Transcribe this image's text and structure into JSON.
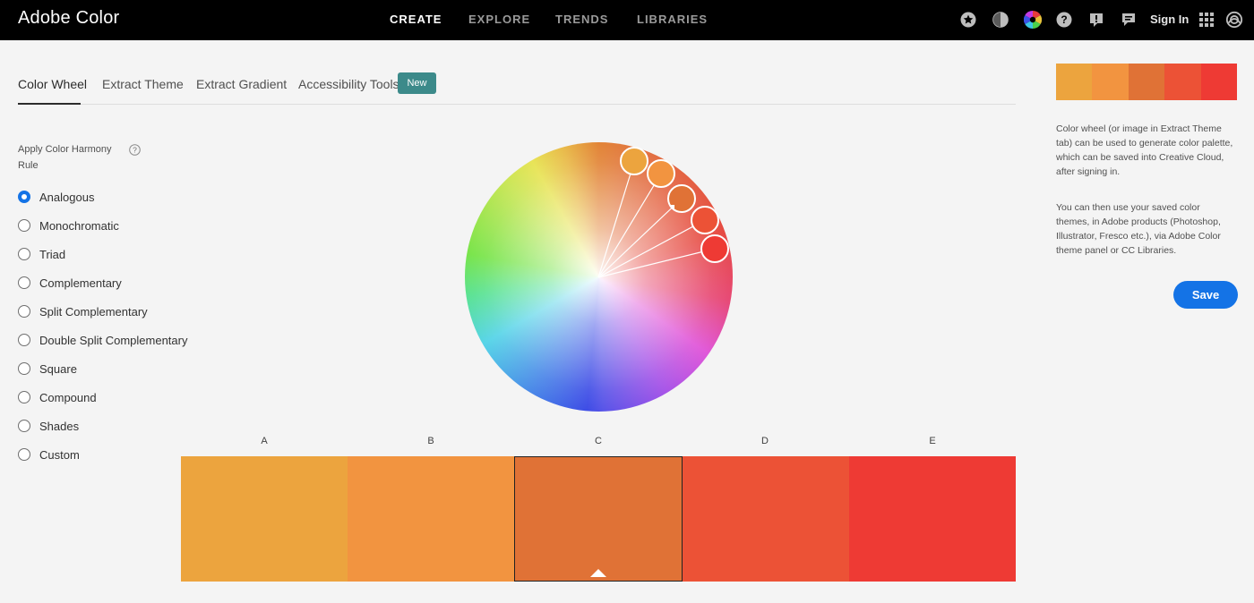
{
  "app": {
    "title": "Adobe Color"
  },
  "topnav": {
    "items": [
      {
        "label": "CREATE",
        "active": true
      },
      {
        "label": "EXPLORE",
        "active": false
      },
      {
        "label": "TRENDS",
        "active": false
      },
      {
        "label": "LIBRARIES",
        "active": false
      }
    ],
    "icons": [
      "star-icon",
      "contrast-icon",
      "color-wheel-icon",
      "help-icon",
      "feedback-icon",
      "chat-icon"
    ],
    "sign_in": "Sign In",
    "app_icons": [
      "apps-grid-icon",
      "creative-cloud-icon"
    ]
  },
  "tabs": {
    "items": [
      {
        "label": "Color Wheel",
        "active": true
      },
      {
        "label": "Extract Theme",
        "active": false
      },
      {
        "label": "Extract Gradient",
        "active": false
      },
      {
        "label": "Accessibility Tools",
        "active": false
      }
    ],
    "new_badge": "New"
  },
  "harmony": {
    "title": "Apply Color Harmony Rule",
    "options": [
      "Analogous",
      "Monochromatic",
      "Triad",
      "Complementary",
      "Split Complementary",
      "Double Split Complementary",
      "Square",
      "Compound",
      "Shades",
      "Custom"
    ],
    "selected": "Analogous"
  },
  "swatches": [
    {
      "letter": "A",
      "color": "#eca43e",
      "selected": false
    },
    {
      "letter": "B",
      "color": "#f29440",
      "selected": false
    },
    {
      "letter": "C",
      "color": "#e07236",
      "selected": true
    },
    {
      "letter": "D",
      "color": "#ec5236",
      "selected": false
    },
    {
      "letter": "E",
      "color": "#ee3a34",
      "selected": false
    }
  ],
  "right_panel": {
    "description_1": "Color wheel (or image in Extract Theme tab) can be used to generate color palette, which can be saved into Creative Cloud, after signing in.",
    "description_2": "You can then use your saved color themes, in Adobe products (Photoshop, Illustrator, Fresco etc.), via Adobe Color theme panel or CC Libraries.",
    "save_label": "Save"
  },
  "colors": {
    "accent": "#1473e6",
    "topbar": "#000000",
    "new_badge": "#3c8a8a"
  }
}
